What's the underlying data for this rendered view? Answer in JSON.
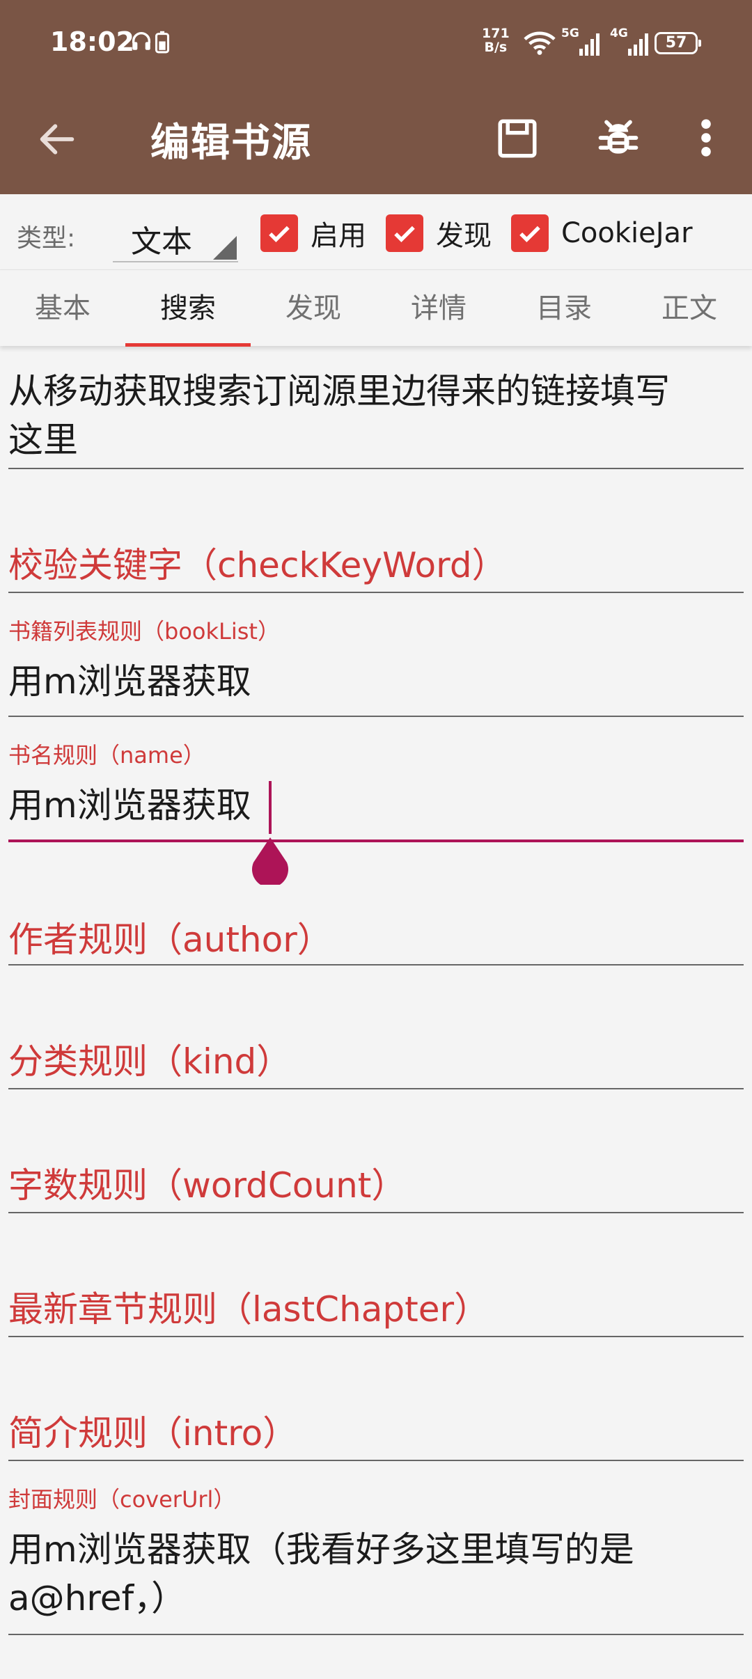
{
  "status_bar": {
    "time": "18:02",
    "net_speed_value": "171",
    "net_speed_unit": "B/s",
    "label_5g": "5G",
    "label_4g": "4G",
    "battery": "57"
  },
  "toolbar": {
    "title": "编辑书源",
    "icons": [
      "arrow-back-icon",
      "save-icon",
      "bug-icon",
      "more-vert-icon"
    ]
  },
  "type_row": {
    "label": "类型:",
    "selected_type": "文本",
    "checkboxes": [
      {
        "label": "启用",
        "checked": true
      },
      {
        "label": "发现",
        "checked": true
      },
      {
        "label": "CookieJar",
        "checked": true
      }
    ]
  },
  "tabs": [
    {
      "label": "基本",
      "active": false
    },
    {
      "label": "搜索",
      "active": true
    },
    {
      "label": "发现",
      "active": false
    },
    {
      "label": "详情",
      "active": false
    },
    {
      "label": "目录",
      "active": false
    },
    {
      "label": "正文",
      "active": false
    }
  ],
  "fields": {
    "search_url": {
      "value_line1": "从移动获取搜索订阅源里边得来的链接填写",
      "value_line2": "这里"
    },
    "check_keyword": {
      "hint": "校验关键字（checkKeyWord）"
    },
    "book_list": {
      "label": "书籍列表规则（bookList）",
      "value": "用m浏览器获取"
    },
    "name": {
      "label": "书名规则（name）",
      "value": "用m浏览器获取"
    },
    "author": {
      "hint": "作者规则（author）"
    },
    "kind": {
      "hint": "分类规则（kind）"
    },
    "word_count": {
      "hint": "字数规则（wordCount）"
    },
    "last_chapter": {
      "hint": "最新章节规则（lastChapter）"
    },
    "intro": {
      "hint": "简介规则（intro）"
    },
    "cover_url": {
      "label": "封面规则（coverUrl）",
      "value_line1": "用m浏览器获取（我看好多这里填写的是",
      "value_line2": "a@href，）"
    }
  },
  "colors": {
    "appbar": "#7a5545",
    "accent_red": "#e53935",
    "label_red": "#cf3a3a",
    "focus_magenta": "#ad1457",
    "background": "#f4f4f4"
  }
}
